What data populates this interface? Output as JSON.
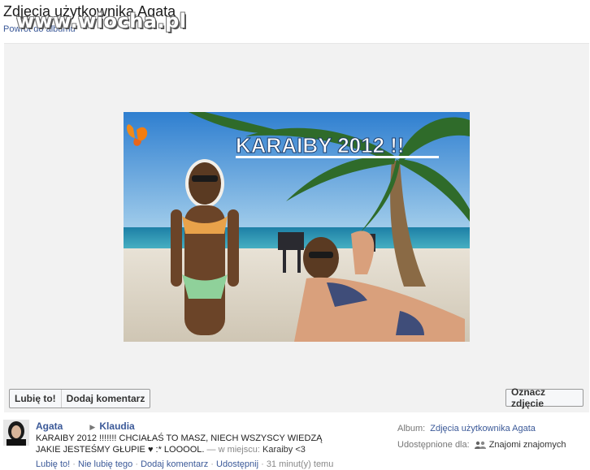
{
  "header": {
    "title": "Zdjęcia użytkownika Agata",
    "back_link": "Powrót do albumu",
    "watermark": "www.wiocha.pl"
  },
  "photo": {
    "caption_text": "KARAIBY 2012 !!"
  },
  "buttons": {
    "like": "Lubię to!",
    "comment": "Dodaj komentarz",
    "tag": "Oznacz zdjęcie"
  },
  "post": {
    "author": "Agata",
    "recipient": "Klaudia",
    "text": "KARAIBY 2012 !!!!!!! CHCIAŁAŚ TO MASZ, NIECH WSZYSCY WIEDZĄ JAKIE JESTEŚMY GŁUPIE ♥ :* LOOOOL.",
    "place_prefix": "— w miejscu:",
    "place": "Karaiby <3",
    "actions": {
      "like": "Lubię to!",
      "unlike": "Nie lubię tego",
      "comment": "Dodaj komentarz",
      "share": "Udostępnij",
      "time": "31 minut(y) temu"
    }
  },
  "sidebar": {
    "album_label": "Album:",
    "album_value": "Zdjęcia użytkownika Agata",
    "shared_label": "Udostępnione dla:",
    "shared_value": "Znajomi znajomych"
  },
  "colors": {
    "link": "#3b5998",
    "stage_bg": "#f2f2f2",
    "button_bg": "#f6f7f9"
  }
}
